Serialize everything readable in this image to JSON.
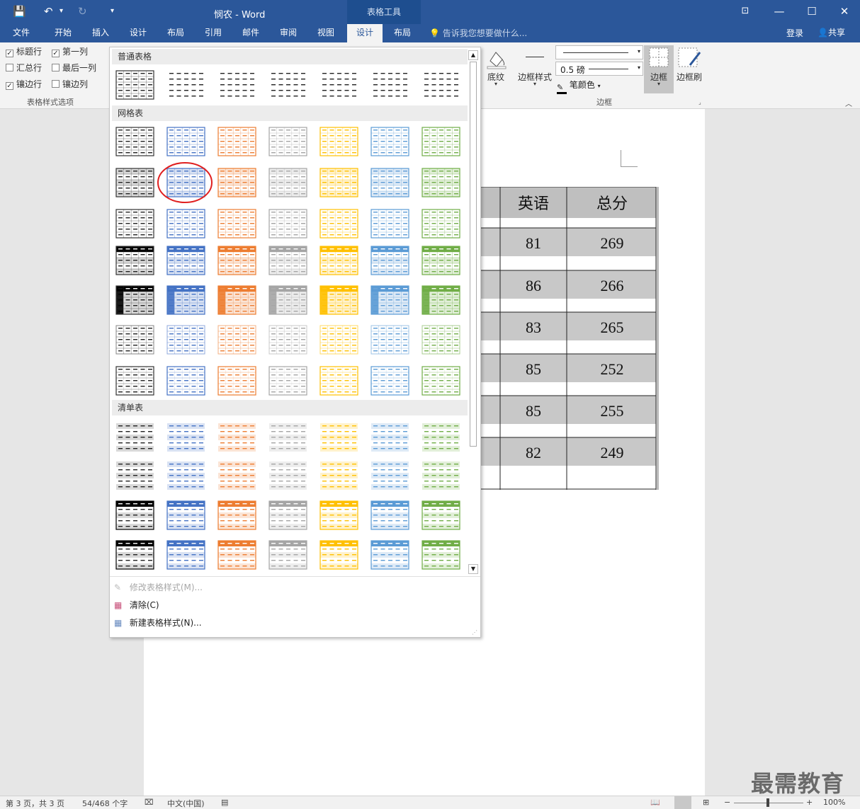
{
  "window": {
    "title": "悯农 - Word",
    "context_tool": "表格工具",
    "min_symbol": "—",
    "max_symbol": "☐",
    "close_symbol": "✕",
    "ribbon_display_symbol": "⊡"
  },
  "quick_access": {
    "save_symbol": "💾",
    "undo_symbol": "↶",
    "redo_symbol": "↻",
    "customize_symbol": "▾"
  },
  "tabs": [
    "文件",
    "开始",
    "插入",
    "设计",
    "布局",
    "引用",
    "邮件",
    "审阅",
    "视图",
    "设计",
    "布局"
  ],
  "active_tab_index": 9,
  "tell_me": "告诉我您想要做什么...",
  "login": "登录",
  "share": "共享",
  "style_options": {
    "items": [
      {
        "label": "标题行",
        "checked": true
      },
      {
        "label": "第一列",
        "checked": true
      },
      {
        "label": "汇总行",
        "checked": false
      },
      {
        "label": "最后一列",
        "checked": false
      },
      {
        "label": "镶边行",
        "checked": true
      },
      {
        "label": "镶边列",
        "checked": false
      }
    ],
    "group_label": "表格样式选项"
  },
  "borders_group": {
    "shading": "底纹",
    "border_styles": "边框样式",
    "weight": "0.5 磅",
    "pen_color": "笔颜色",
    "borders": "边框",
    "border_painter": "边框刷",
    "group_label": "边框"
  },
  "gallery": {
    "sections": [
      "普通表格",
      "网格表",
      "清单表"
    ],
    "selected": {
      "section": "网格表",
      "row": 2,
      "col": 2
    },
    "colors": [
      "#000000",
      "#4472c4",
      "#ed7d31",
      "#a5a5a5",
      "#ffc000",
      "#5b9bd5",
      "#70ad47"
    ],
    "light_colors": [
      "#d9d9d9",
      "#d9e2f3",
      "#fbe4d5",
      "#ededed",
      "#fff2cc",
      "#deeaf6",
      "#e2efd9"
    ],
    "footer": [
      {
        "label": "修改表格样式(M)...",
        "enabled": false
      },
      {
        "label": "清除(C)",
        "enabled": true
      },
      {
        "label": "新建表格样式(N)...",
        "enabled": true
      }
    ]
  },
  "document": {
    "headers": [
      "英语",
      "总分"
    ],
    "rows": [
      [
        "81",
        "269"
      ],
      [
        "86",
        "266"
      ],
      [
        "83",
        "265"
      ],
      [
        "85",
        "252"
      ],
      [
        "85",
        "255"
      ],
      [
        "82",
        "249"
      ]
    ]
  },
  "status": {
    "page": "第 3 页，共 3 页",
    "words": "54/468 个字",
    "language": "中文(中国)",
    "zoom": "100%"
  },
  "watermark": "最需教育"
}
